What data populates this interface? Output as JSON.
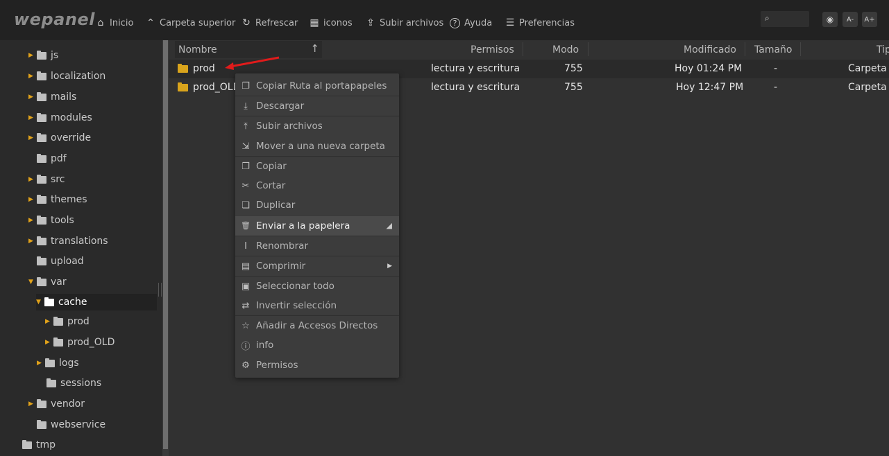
{
  "app": {
    "logo": "wepanel"
  },
  "toolbar": {
    "items": [
      {
        "icon": "home-icon",
        "glyph": "⌂",
        "label": "Inicio"
      },
      {
        "icon": "chevron-up-icon",
        "glyph": "⌃",
        "label": "Carpeta superior"
      },
      {
        "icon": "refresh-icon",
        "glyph": "↻",
        "label": "Refrescar"
      },
      {
        "icon": "grid-icon",
        "glyph": "▦",
        "label": "iconos"
      },
      {
        "icon": "upload-icon",
        "glyph": "⇪",
        "label": "Subir archivos"
      },
      {
        "icon": "help-icon",
        "glyph": "?",
        "label": "Ayuda"
      },
      {
        "icon": "sliders-icon",
        "glyph": "☰",
        "label": "Preferencias"
      }
    ],
    "search_glyph": "⌕",
    "view_glyph": "◉",
    "font_minus": "A-",
    "font_plus": "A+"
  },
  "sidebar": {
    "items": [
      {
        "label": "js",
        "expand": "▶"
      },
      {
        "label": "localization",
        "expand": "▶"
      },
      {
        "label": "mails",
        "expand": "▶"
      },
      {
        "label": "modules",
        "expand": "▶"
      },
      {
        "label": "override",
        "expand": "▶"
      },
      {
        "label": "pdf",
        "expand": ""
      },
      {
        "label": "src",
        "expand": "▶"
      },
      {
        "label": "themes",
        "expand": "▶"
      },
      {
        "label": "tools",
        "expand": "▶"
      },
      {
        "label": "translations",
        "expand": "▶"
      },
      {
        "label": "upload",
        "expand": ""
      },
      {
        "label": "var",
        "expand": "▼"
      },
      {
        "label": "cache",
        "expand": "▼"
      },
      {
        "label": "prod",
        "expand": "▶"
      },
      {
        "label": "prod_OLD",
        "expand": "▶"
      },
      {
        "label": "logs",
        "expand": "▶"
      },
      {
        "label": "sessions",
        "expand": ""
      },
      {
        "label": "vendor",
        "expand": "▶"
      },
      {
        "label": "webservice",
        "expand": ""
      },
      {
        "label": "tmp",
        "expand": ""
      }
    ]
  },
  "columns": {
    "name": "Nombre",
    "sort_glyph": "↑",
    "perms": "Permisos",
    "mode": "Modo",
    "modified": "Modificado",
    "size": "Tamaño",
    "type": "Tip"
  },
  "files": [
    {
      "name": "prod",
      "perms": "lectura y escritura",
      "mode": "755",
      "modified": "Hoy 01:24 PM",
      "size": "-",
      "type": "Carpeta"
    },
    {
      "name": "prod_OLD",
      "perms": "lectura y escritura",
      "mode": "755",
      "modified": "Hoy 12:47 PM",
      "size": "-",
      "type": "Carpeta"
    }
  ],
  "context_menu": {
    "items": [
      {
        "icon": "copy-path-icon",
        "glyph": "❐",
        "label": "Copiar Ruta al portapapeles"
      },
      {
        "icon": "download-icon",
        "glyph": "⤓",
        "label": "Descargar"
      },
      {
        "icon": "upload-icon",
        "glyph": "⤒",
        "label": "Subir archivos"
      },
      {
        "icon": "move-folder-icon",
        "glyph": "⇲",
        "label": "Mover a una nueva carpeta"
      },
      {
        "icon": "copy-icon",
        "glyph": "❐",
        "label": "Copiar"
      },
      {
        "icon": "scissors-icon",
        "glyph": "✂",
        "label": "Cortar"
      },
      {
        "icon": "duplicate-icon",
        "glyph": "❏",
        "label": "Duplicar"
      },
      {
        "icon": "trash-icon",
        "glyph": "🗑",
        "label": "Enviar a la papelera",
        "right": "◢"
      },
      {
        "icon": "rename-icon",
        "glyph": "I",
        "label": "Renombrar"
      },
      {
        "icon": "compress-icon",
        "glyph": "▤",
        "label": "Comprimir",
        "right": "▶"
      },
      {
        "icon": "select-all-icon",
        "glyph": "▣",
        "label": "Seleccionar todo"
      },
      {
        "icon": "invert-selection-icon",
        "glyph": "⇄",
        "label": "Invertir selección"
      },
      {
        "icon": "star-icon",
        "glyph": "☆",
        "label": "Añadir a Accesos Directos"
      },
      {
        "icon": "info-icon",
        "glyph": "ⓘ",
        "label": "info"
      },
      {
        "icon": "gear-icon",
        "glyph": "⚙",
        "label": "Permisos"
      }
    ]
  }
}
